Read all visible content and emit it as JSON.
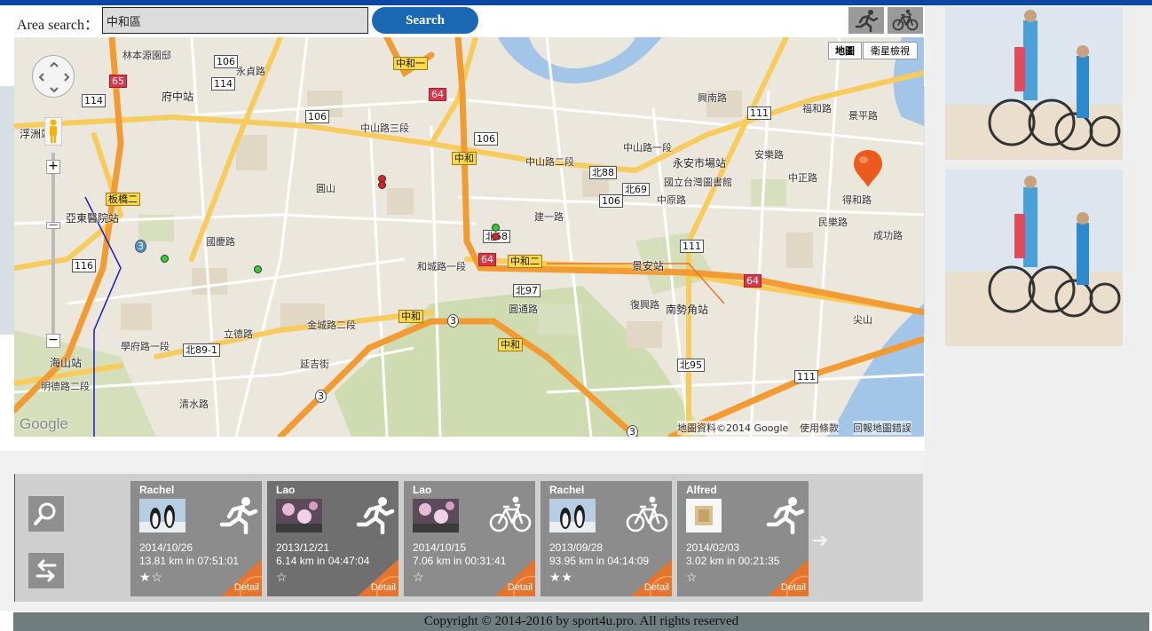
{
  "search": {
    "label": "Area search：",
    "value": "中和區",
    "button_label": "Search"
  },
  "map": {
    "type_map": "地圖",
    "type_satellite": "衛星檢視",
    "attribution": "地圖資料©2014 Google",
    "terms": "使用條款",
    "report": "回報地圖錯誤",
    "logo": "Google",
    "zoom_in": "+",
    "zoom_out": "−",
    "labels": {
      "linben": "林本源園邸",
      "fuzhong": "府中站",
      "fuzhou": "浮洲站",
      "banqiao2": "板橋二",
      "yadong": "亞東醫院站",
      "haishan": "海山站",
      "yongan": "永安市場站",
      "library": "國立台灣圖書館",
      "jingan": "景安站",
      "nanshijiao": "南勢角站",
      "zhonghe1": "中和一",
      "zhonghe2": "中和二",
      "zhonghe": "中和",
      "zhonghe_b": "中和",
      "zhonghe_c": "中和",
      "zhongshan3": "中山路三段",
      "zhongshan2": "中山路二段",
      "zhongshan1": "中山路一段",
      "hehe": "和城路一段",
      "jinggang": "金城路二段",
      "jianyi": "建一路",
      "yuantong": "圓通路",
      "lide": "立德路",
      "xuefu": "學府路一段",
      "fuxing": "復興路",
      "mingde": "明德路二段",
      "yongzhen": "永貞路",
      "dehe": "得和路",
      "zhongzheng": "中正路",
      "xingnan": "興南路",
      "anle": "安樂路",
      "minle": "民樂路",
      "zhongyuan": "中原路",
      "guoguang": "國慶路",
      "qinshui": "清水路",
      "yanjiao": "延吉街",
      "jiqiu": "景平路",
      "chenggong": "成功路",
      "fuhe": "福和路",
      "yuanshan": "圓山",
      "jianshan": "尖山"
    },
    "shields": {
      "s106a": "106",
      "s114a": "114",
      "s114b": "114",
      "s106b": "106",
      "s106c": "106",
      "s106d": "106",
      "s106e": "106",
      "s116": "116",
      "s65": "65",
      "s64a": "64",
      "s64b": "64",
      "s64c": "64",
      "s3a": "3",
      "s3b": "3",
      "s3c": "3",
      "s3d": "3",
      "s111a": "111",
      "s111b": "111",
      "s111c": "111",
      "n88": "北88",
      "n69": "北69",
      "n68": "北68",
      "n97": "北97",
      "n95": "北95",
      "n891": "北89-1"
    }
  },
  "workouts": [
    {
      "user": "Rachel",
      "date": "2014/10/26",
      "stats": "13.81 km in 07:51:01",
      "stars": "★☆",
      "sport": "running",
      "detail": "Detail"
    },
    {
      "user": "Lao",
      "date": "2013/12/21",
      "stats": "6.14 km in 04:47:04",
      "stars": "☆",
      "sport": "running",
      "detail": "Detail"
    },
    {
      "user": "Lao",
      "date": "2014/10/15",
      "stats": "7.06 km in 00:31:41",
      "stars": "☆",
      "sport": "cycling",
      "detail": "Detail"
    },
    {
      "user": "Rachel",
      "date": "2013/09/28",
      "stats": "93.95 km in 04:14:09",
      "stars": "★★",
      "sport": "cycling",
      "detail": "Detail"
    },
    {
      "user": "Alfred",
      "date": "2014/02/03",
      "stats": "3.02 km in 00:21:35",
      "stars": "☆",
      "sport": "running",
      "detail": "Detail"
    }
  ],
  "footer": {
    "copyright": "Copyright © 2014-2016 by sport4u.pro. All rights reserved"
  },
  "colors": {
    "brand_blue": "#1a67b4",
    "top_stripe": "#0c47a1",
    "detail_orange": "#e8732a",
    "footer_bg": "#6f7d7f"
  }
}
